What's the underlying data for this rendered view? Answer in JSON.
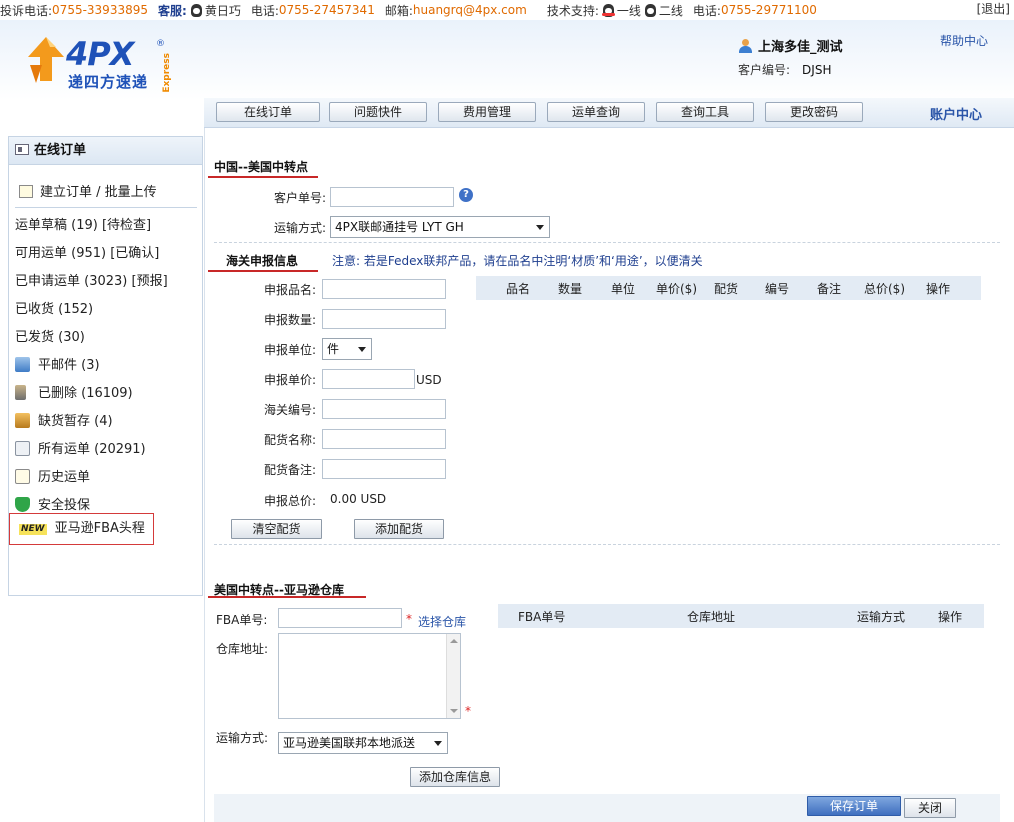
{
  "topbar": {
    "complaint_label": "投诉电话:",
    "complaint_phone": "0755-33933895",
    "cs_label": "客服:",
    "cs_name": "黄日巧",
    "phone_label": "电话:",
    "phone": "0755-27457341",
    "email_label": "邮箱:",
    "email": "huangrq@4px.com",
    "tech_label": "技术支持:",
    "line1": "一线",
    "line2": "二线",
    "phone2_label": "电话:",
    "phone2": "0755-29771100",
    "logout": "[退出]"
  },
  "header": {
    "logo_text": "4PX",
    "logo_reg": "®",
    "logo_cn": "递四方速递",
    "logo_express": "Express",
    "user_name": "上海多佳_测试",
    "customer_code_label": "客户编号:",
    "customer_code": "DJSH",
    "help": "帮助中心"
  },
  "nav": {
    "items": [
      {
        "label": "在线订单"
      },
      {
        "label": "问题快件"
      },
      {
        "label": "费用管理"
      },
      {
        "label": "运单查询"
      },
      {
        "label": "查询工具"
      },
      {
        "label": "更改密码"
      }
    ],
    "account": "账户中心"
  },
  "sidebar": {
    "title": "在线订单",
    "create": "建立订单 / 批量上传",
    "items": [
      {
        "label": "运单草稿 (19) [待检查]"
      },
      {
        "label": "可用运单 (951) [已确认]"
      },
      {
        "label": "已申请运单 (3023) [预报]"
      },
      {
        "label": "已收货 (152)"
      },
      {
        "label": "已发货 (30)"
      },
      {
        "label": "平邮件 (3)",
        "icon": "upload-icon"
      },
      {
        "label": "已删除 (16109)",
        "icon": "hourglass-icon"
      },
      {
        "label": "缺货暂存 (4)",
        "icon": "box-icon"
      },
      {
        "label": "所有运单 (20291)",
        "icon": "documents-icon"
      },
      {
        "label": "历史运单",
        "icon": "history-icon"
      },
      {
        "label": "安全投保",
        "icon": "shield-check-icon"
      }
    ],
    "new_badge": "NEW",
    "new_item": "亚马逊FBA头程"
  },
  "section1": {
    "title": "中国--美国中转点",
    "customer_order_label": "客户单号:",
    "customer_order_value": "",
    "shipping_label": "运输方式:",
    "shipping_value": "4PX联邮通挂号  LYT GH"
  },
  "customs": {
    "title": "海关申报信息",
    "note": "注意: 若是Fedex联邦产品，请在品名中注明‘材质’和‘用途’，以便清关",
    "fields": {
      "name_label": "申报品名:",
      "qty_label": "申报数量:",
      "unit_label": "申报单位:",
      "unit_value": "件",
      "price_label": "申报单价:",
      "price_unit": "USD",
      "hs_label": "海关编号:",
      "goods_name_label": "配货名称:",
      "goods_note_label": "配货备注:",
      "total_label": "申报总价:",
      "total_value": "0.00 USD"
    },
    "table_headers": [
      "品名",
      "数量",
      "单位",
      "单价($)",
      "配货",
      "编号",
      "备注",
      "总价($)",
      "操作"
    ],
    "clear_button": "清空配货",
    "add_button": "添加配货"
  },
  "section2": {
    "title": "美国中转点--亚马逊仓库",
    "fba_label": "FBA单号:",
    "choose_warehouse": "选择仓库",
    "warehouse_addr_label": "仓库地址:",
    "shipping_label": "运输方式:",
    "shipping_value": "亚马逊美国联邦本地派送",
    "table_headers": [
      "FBA单号",
      "仓库地址",
      "运输方式",
      "操作"
    ],
    "add_warehouse_button": "添加仓库信息"
  },
  "footer": {
    "save": "保存订单",
    "close": "关闭"
  },
  "colors": {
    "accent_blue": "#2a55a8",
    "orange": "#e06a00",
    "red": "#c82828"
  }
}
